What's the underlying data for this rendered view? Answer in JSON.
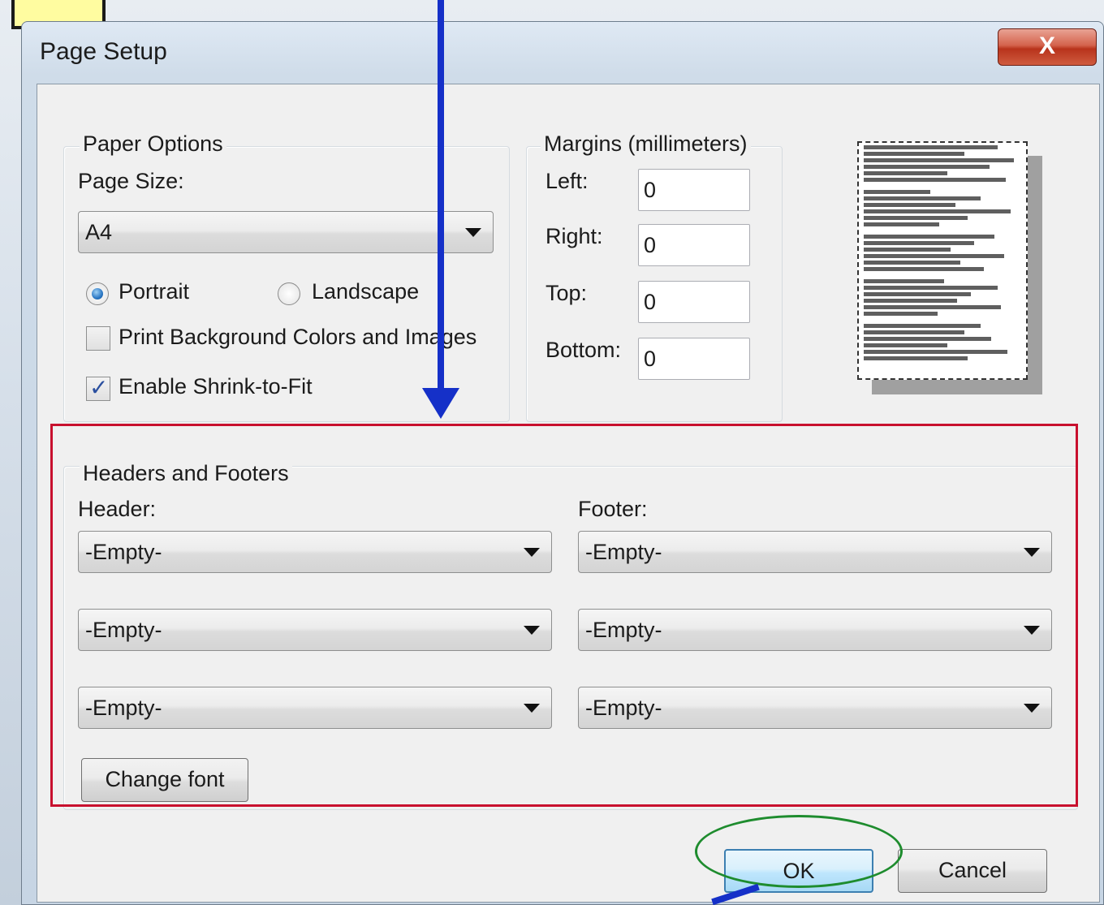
{
  "window": {
    "title": "Page Setup",
    "close_label": "X"
  },
  "paper_options": {
    "group_label": "Paper Options",
    "page_size_label": "Page Size:",
    "page_size_value": "A4",
    "portrait_label": "Portrait",
    "landscape_label": "Landscape",
    "orientation_selected": "Portrait",
    "print_background_label": "Print Background Colors and Images",
    "print_background_checked": false,
    "shrink_to_fit_label": "Enable Shrink-to-Fit",
    "shrink_to_fit_checked": true
  },
  "margins": {
    "group_label": "Margins (millimeters)",
    "left_label": "Left:",
    "left_value": "0",
    "right_label": "Right:",
    "right_value": "0",
    "top_label": "Top:",
    "top_value": "0",
    "bottom_label": "Bottom:",
    "bottom_value": "0"
  },
  "headers_footers": {
    "group_label": "Headers and Footers",
    "header_label": "Header:",
    "footer_label": "Footer:",
    "header_values": [
      "-Empty-",
      "-Empty-",
      "-Empty-"
    ],
    "footer_values": [
      "-Empty-",
      "-Empty-",
      "-Empty-"
    ],
    "change_font_label": "Change font"
  },
  "buttons": {
    "ok_label": "OK",
    "cancel_label": "Cancel"
  },
  "annotation_colors": {
    "highlight_box": "#c8102e",
    "ok_ellipse": "#1e8c2e",
    "arrow": "#1530c8",
    "note": "#fffca0"
  }
}
